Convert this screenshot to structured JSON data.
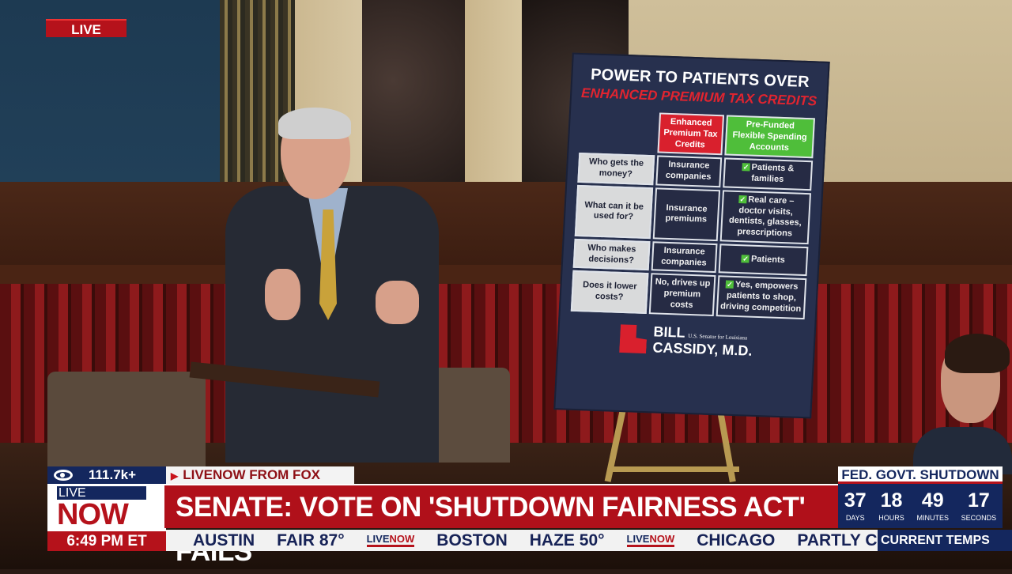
{
  "live_badge": "LIVE",
  "poster": {
    "title": "POWER TO PATIENTS OVER",
    "subtitle": "ENHANCED PREMIUM TAX CREDITS",
    "columns": [
      "Enhanced Premium Tax Credits",
      "Pre-Funded Flexible Spending Accounts"
    ],
    "rows": [
      {
        "question": "Who gets the money?",
        "eptc": "Insurance companies",
        "fsa": "Patients & families"
      },
      {
        "question": "What can it be used for?",
        "eptc": "Insurance premiums",
        "fsa": "Real care – doctor visits, dentists, glasses, prescriptions"
      },
      {
        "question": "Who makes decisions?",
        "eptc": "Insurance companies",
        "fsa": "Patients"
      },
      {
        "question": "Does it lower costs?",
        "eptc": "No, drives up premium costs",
        "fsa": "Yes, empowers patients to shop, driving competition"
      }
    ],
    "check": "✓",
    "name_line1": "BILL",
    "senator": "U.S. Senator for Louisiana",
    "name_line2": "CASSIDY, M.D."
  },
  "lower_third": {
    "viewers": "111.7k+",
    "source": "LIVENOW FROM FOX",
    "logo_live": "LIVE",
    "logo_now": "NOW",
    "time": "6:49 PM ET",
    "headline": "SENATE: VOTE ON 'SHUTDOWN FAIRNESS ACT' FAILS",
    "ticker": [
      "AUSTIN",
      "FAIR 87°",
      "BOSTON",
      "HAZE 50°",
      "CHICAGO",
      "PARTLY C"
    ],
    "ticker_logo_live": "LIVE",
    "ticker_logo_now": "NOW",
    "ticker_label": "CURRENT TEMPS"
  },
  "countdown": {
    "title": "FED. GOVT. SHUTDOWN",
    "units": [
      {
        "value": "37",
        "label": "DAYS"
      },
      {
        "value": "18",
        "label": "HOURS"
      },
      {
        "value": "49",
        "label": "MINUTES"
      },
      {
        "value": "17",
        "label": "SECONDS"
      }
    ]
  },
  "colors": {
    "red": "#b5121b",
    "navy": "#14275e",
    "green": "#4fbe3a"
  }
}
